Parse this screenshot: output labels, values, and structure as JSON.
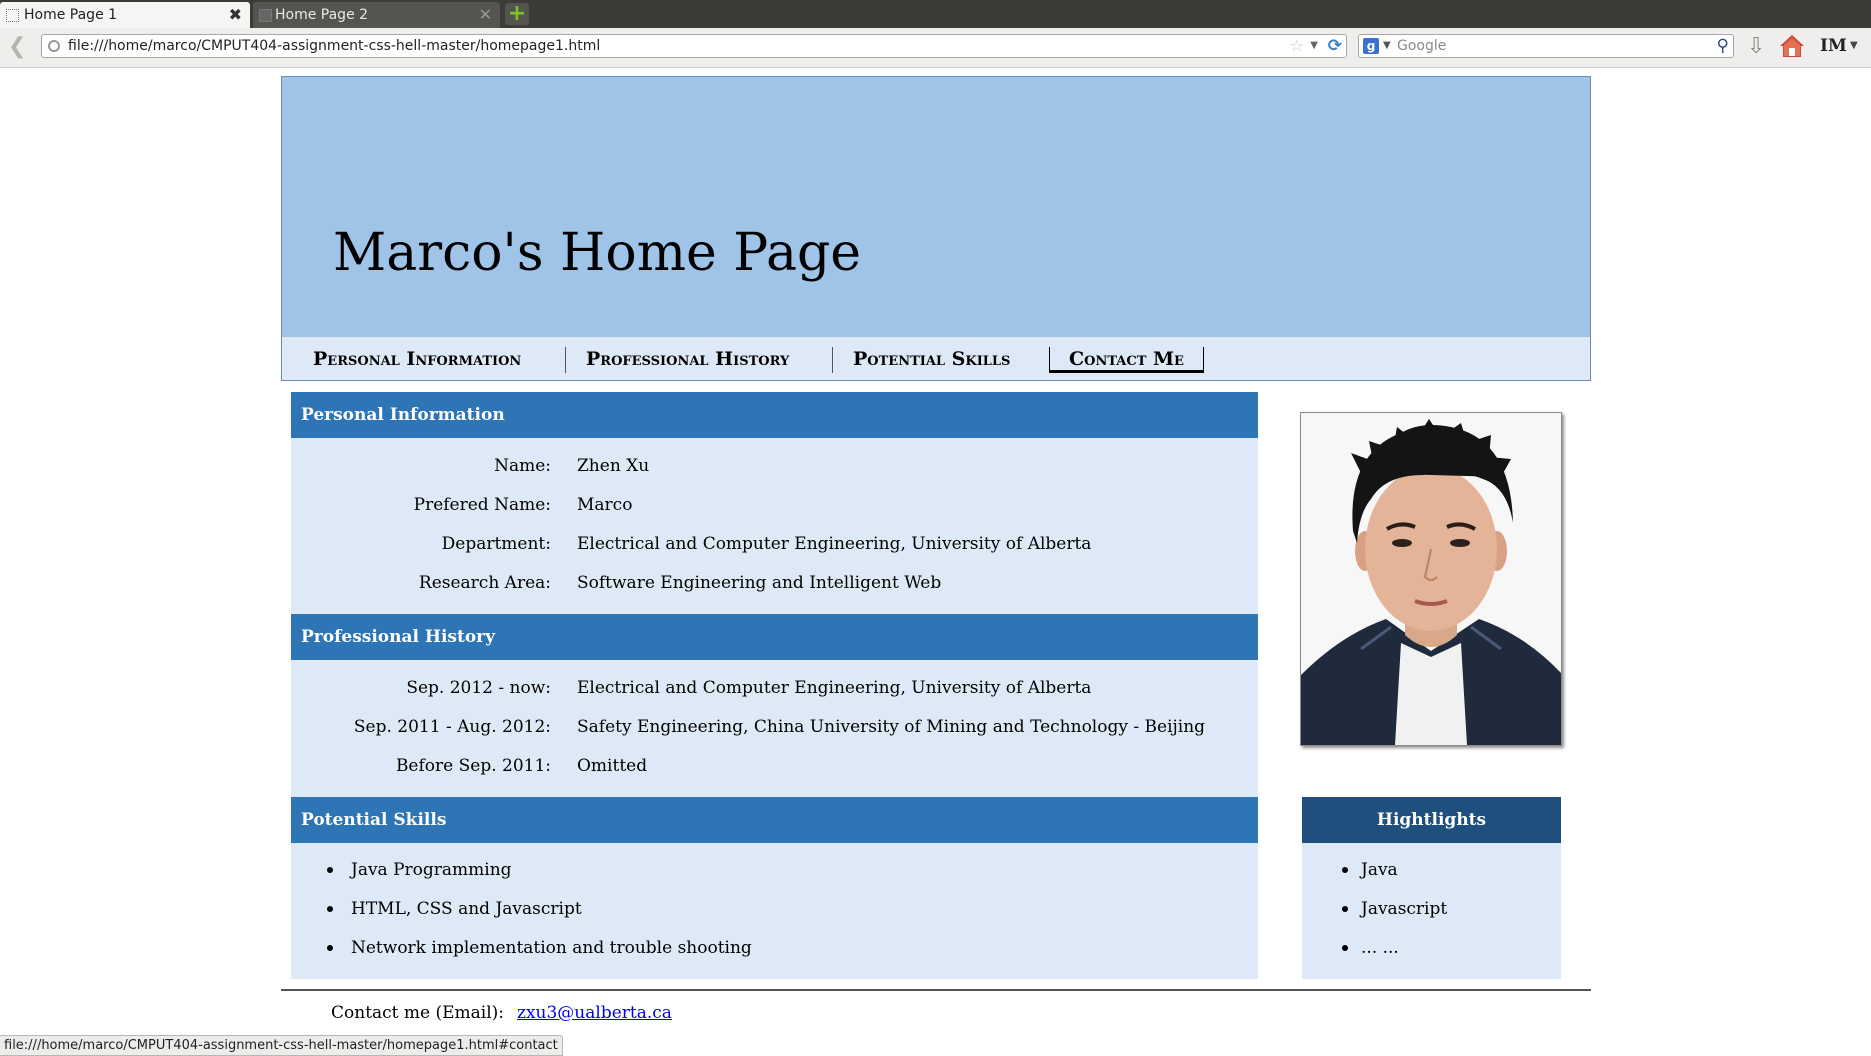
{
  "browser": {
    "tabs": [
      {
        "label": "Home Page 1",
        "active": true
      },
      {
        "label": "Home Page 2",
        "active": false
      }
    ],
    "new_tab_icon": "plus-icon",
    "url": "file:///home/marco/CMPUT404-assignment-css-hell-master/homepage1.html",
    "search_placeholder": "Google",
    "search_engine_letter": "g",
    "toolbar_im": "IM",
    "status_url": "file:///home/marco/CMPUT404-assignment-css-hell-master/homepage1.html#contact",
    "accent_colors": {
      "new_tab": "#7ec12a",
      "reload": "#3b7ec6",
      "home": "#c8483a"
    }
  },
  "page": {
    "title": "Marco's Home Page",
    "colors": {
      "banner": "#9fc4e8",
      "section_header": "#2e75b6",
      "section_body": "#dde9f6",
      "highlights_header": "#1e4f7e",
      "link": "#0000ee"
    },
    "nav": [
      {
        "label": "Personal Information",
        "current": false
      },
      {
        "label": "Professional History",
        "current": false
      },
      {
        "label": "Potential Skills",
        "current": false
      },
      {
        "label": "Contact Me",
        "current": true
      }
    ],
    "sections": {
      "personal": {
        "heading": "Personal Information",
        "rows": [
          {
            "label": "Name:",
            "value": "Zhen Xu"
          },
          {
            "label": "Prefered Name:",
            "value": "Marco"
          },
          {
            "label": "Department:",
            "value": "Electrical and Computer Engineering, University of Alberta"
          },
          {
            "label": "Research Area:",
            "value": "Software Engineering and Intelligent Web"
          }
        ]
      },
      "professional": {
        "heading": "Professional History",
        "rows": [
          {
            "label": "Sep. 2012 - now:",
            "value": "Electrical and Computer Engineering, University of Alberta"
          },
          {
            "label": "Sep. 2011 - Aug. 2012:",
            "value": "Safety Engineering, China University of Mining and Technology - Beijing"
          },
          {
            "label": "Before Sep. 2011:",
            "value": "Omitted"
          }
        ]
      },
      "skills": {
        "heading": "Potential Skills",
        "items": [
          "Java Programming",
          "HTML, CSS and Javascript",
          "Network implementation and trouble shooting"
        ]
      }
    },
    "highlights": {
      "heading": "Hightlights",
      "items": [
        "Java",
        "Javascript",
        "... ..."
      ]
    },
    "contact": {
      "label": "Contact me (Email):",
      "email": "zxu3@ualberta.ca"
    }
  }
}
